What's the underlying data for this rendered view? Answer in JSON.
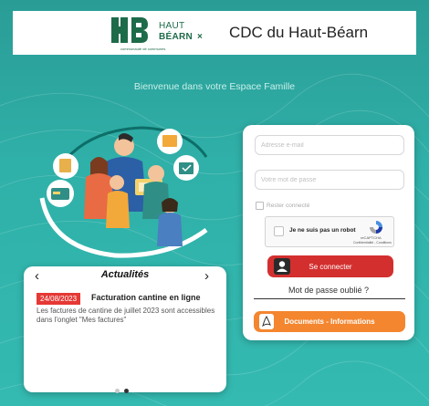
{
  "header": {
    "logo_text_line1": "HAUT",
    "logo_text_line2": "BÉARN",
    "logo_mark": "×",
    "logo_subtitle": "communauté de communes",
    "title": "CDC du Haut-Béarn"
  },
  "welcome": "Bienvenue dans votre Espace Famille",
  "news": {
    "title": "Actualités",
    "prev_icon": "‹",
    "next_icon": "›",
    "items": [
      {
        "date": "24/08/2023",
        "headline": "Facturation cantine en ligne",
        "body": "Les factures de cantine de juillet 2023 sont accessibles dans l'onglet \"Mes factures\""
      }
    ],
    "slide_count": 2,
    "active_slide": 2
  },
  "login": {
    "email_placeholder": "Adresse e-mail",
    "password_placeholder": "Votre mot de passe",
    "remember_label": "Rester connecté",
    "recaptcha_label": "Je ne suis pas un robot",
    "recaptcha_brand": "reCAPTCHA",
    "recaptcha_links": "Confidentialité - Conditions",
    "login_button": "Se connecter",
    "forgot_password": "Mot de passe oublié ?",
    "docs_button": "Documents - Informations"
  },
  "colors": {
    "background": "#2fb0a8",
    "login_button": "#d32f2f",
    "docs_button": "#f4862f",
    "date_badge": "#e53935",
    "brand_green": "#1e6b4a"
  },
  "icons": {
    "user": "user-icon",
    "pdf": "pdf-icon",
    "recaptcha": "recaptcha-icon"
  }
}
